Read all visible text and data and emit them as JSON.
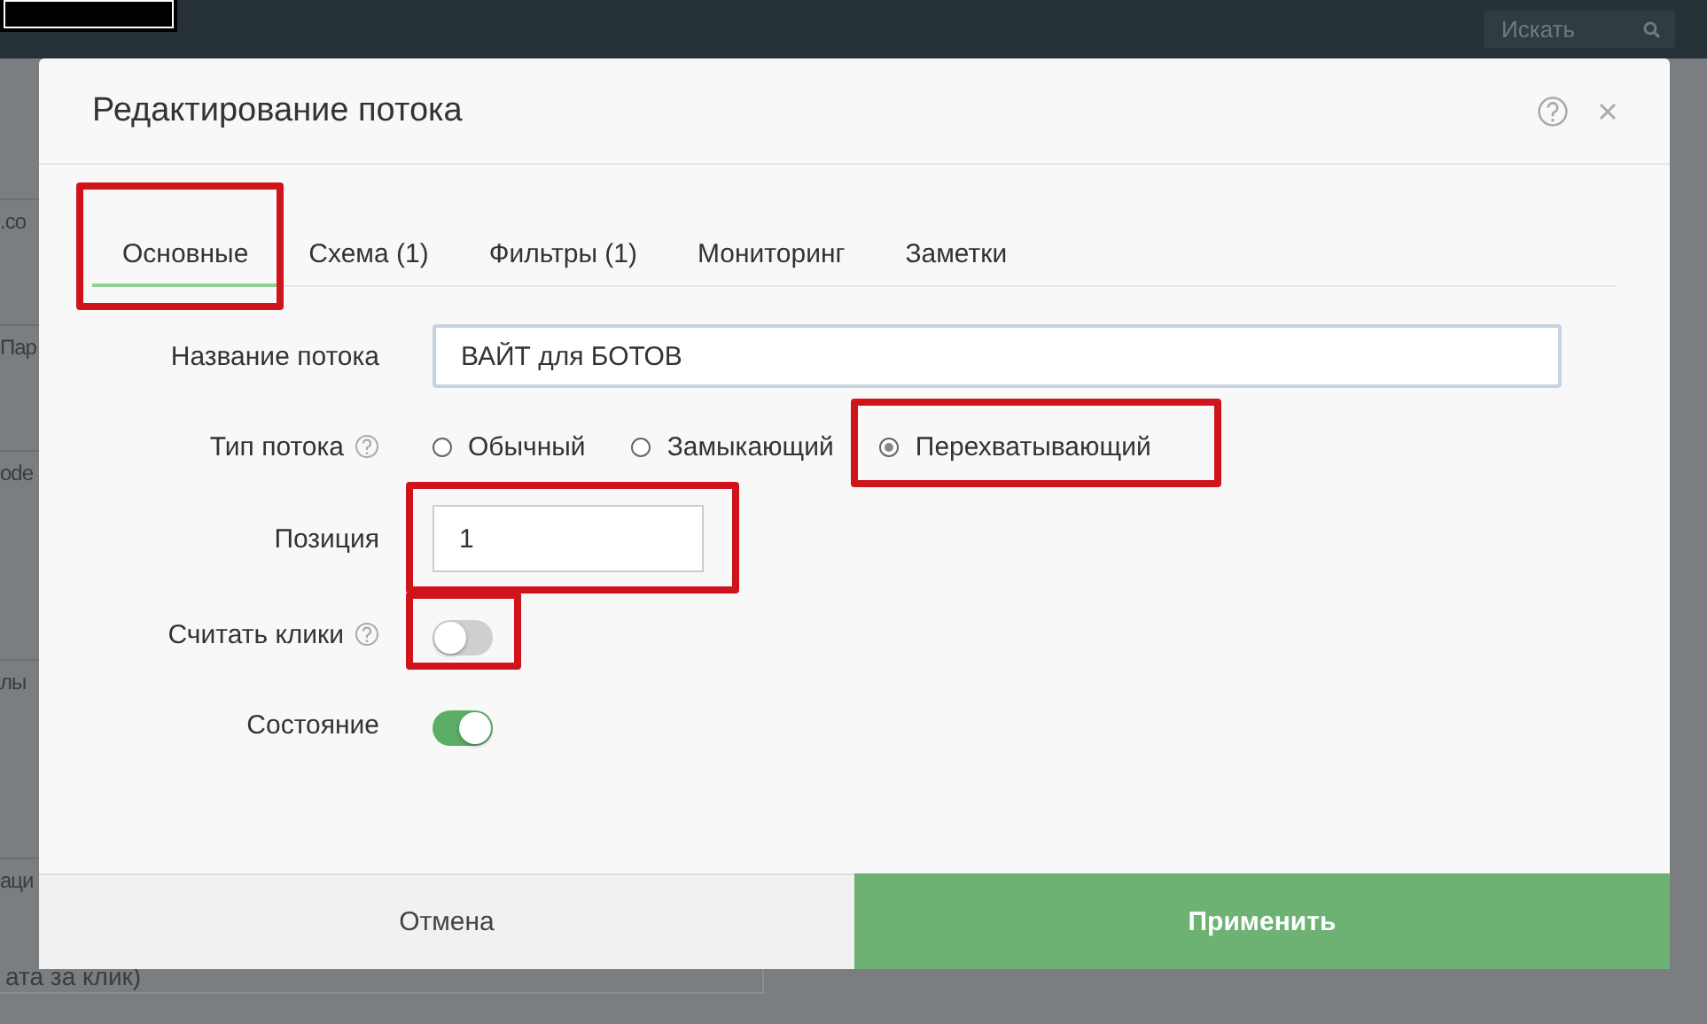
{
  "top_bar": {
    "search": {
      "placeholder": "Искать"
    }
  },
  "background_fragments": [
    ".co",
    "Пар",
    "ode",
    "лы",
    "аци",
    "ата за клик)"
  ],
  "dialog": {
    "title": "Редактирование потока",
    "tabs": [
      {
        "label": "Основные",
        "selected": true,
        "highlighted": true
      },
      {
        "label": "Схема (1)",
        "selected": false,
        "highlighted": false
      },
      {
        "label": "Фильтры (1)",
        "selected": false,
        "highlighted": false
      },
      {
        "label": "Мониторинг",
        "selected": false,
        "highlighted": false
      },
      {
        "label": "Заметки",
        "selected": false,
        "highlighted": false
      }
    ],
    "fields": [
      {
        "kind": "text",
        "label": "Название потока",
        "help": false,
        "value": "ВАЙТ для БОТОВ",
        "highlighted": false
      },
      {
        "kind": "radio",
        "label": "Тип потока",
        "help": true,
        "options": [
          {
            "label": "Обычный",
            "selected": false,
            "highlighted": false
          },
          {
            "label": "Замыкающий",
            "selected": false,
            "highlighted": false
          },
          {
            "label": "Перехватывающий",
            "selected": true,
            "highlighted": true
          }
        ]
      },
      {
        "kind": "number",
        "label": "Позиция",
        "help": false,
        "value": "1",
        "highlighted": true
      },
      {
        "kind": "toggle",
        "label": "Считать клики",
        "help": true,
        "on": false,
        "highlighted": true
      },
      {
        "kind": "toggle",
        "label": "Состояние",
        "help": false,
        "on": true,
        "highlighted": false
      }
    ],
    "buttons": [
      {
        "kind": "cancel",
        "label": "Отмена"
      },
      {
        "kind": "apply",
        "label": "Применить"
      }
    ]
  }
}
